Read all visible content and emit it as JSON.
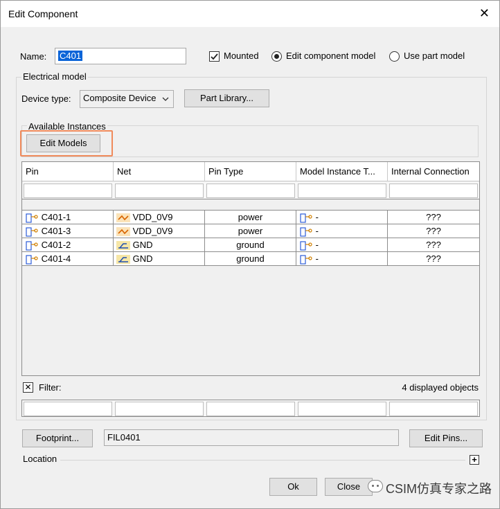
{
  "window": {
    "title": "Edit Component",
    "close_glyph": "✕"
  },
  "name_row": {
    "label": "Name:",
    "value": "C401",
    "mounted_label": "Mounted",
    "mounted_checked": true,
    "edit_model_label": "Edit component model",
    "use_part_label": "Use part model",
    "selected_mode": "edit_component_model"
  },
  "electrical": {
    "title": "Electrical model",
    "device_type_label": "Device type:",
    "device_type_value": "Composite Device",
    "part_library_button": "Part Library...",
    "available_instances_label": "Available Instances",
    "edit_models_button": "Edit Models"
  },
  "table": {
    "columns": [
      "Pin",
      "Net",
      "Pin Type",
      "Model Instance T...",
      "Internal Connection"
    ],
    "rows": [
      {
        "pin": "C401-1",
        "net": "VDD_0V9",
        "net_kind": "power",
        "pin_type": "power",
        "model": "-",
        "internal": "???"
      },
      {
        "pin": "C401-3",
        "net": "VDD_0V9",
        "net_kind": "power",
        "pin_type": "power",
        "model": "-",
        "internal": "???"
      },
      {
        "pin": "C401-2",
        "net": "GND",
        "net_kind": "ground",
        "pin_type": "ground",
        "model": "-",
        "internal": "???"
      },
      {
        "pin": "C401-4",
        "net": "GND",
        "net_kind": "ground",
        "pin_type": "ground",
        "model": "-",
        "internal": "???"
      }
    ]
  },
  "filter": {
    "label": "Filter:",
    "checked": true,
    "check_glyph": "✕",
    "count_text": "4 displayed objects"
  },
  "footprint": {
    "button": "Footprint...",
    "value": "FIL0401",
    "edit_pins_button": "Edit Pins..."
  },
  "location": {
    "label": "Location",
    "expand_glyph": "+"
  },
  "actions": {
    "ok": "Ok",
    "close": "Close"
  },
  "watermark": "CSIM仿真专家之路",
  "colors": {
    "accent_highlight": "#f08a5b",
    "selection": "#0a64d8",
    "power_net": "#e07b00",
    "ground_net": "#1f4fb0"
  }
}
